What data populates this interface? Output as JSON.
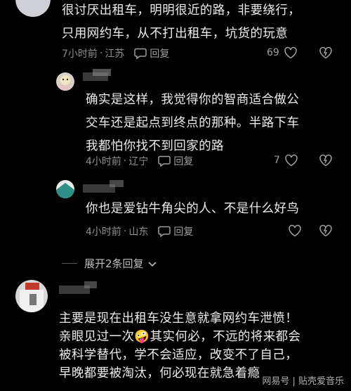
{
  "comments": [
    {
      "text_lines": [
        "很讨厌出租车，明明很近的路，非要绕行，",
        "只用网约车，从不打出租车，坑货的玩意"
      ],
      "time": "7小时前",
      "location": "江苏",
      "reply_label": "回复",
      "likes": "69"
    },
    {
      "text_lines": [
        "确实是这样，我觉得你的智商适合做公",
        "交车还是起点到终点的那种。半路下车",
        "我都怕你找不到回家的路"
      ],
      "time": "4小时前",
      "location": "辽宁",
      "reply_label": "回复",
      "likes": "7"
    },
    {
      "text_lines": [
        "你也是爱钻牛角尖的人、不是什么好鸟"
      ],
      "time": "4小时前",
      "location": "山东",
      "reply_label": "回复",
      "likes": ""
    }
  ],
  "expand_replies": "展开2条回复",
  "bottom_comment": {
    "text_lines": [
      "主要是现在出租车没生意就拿网约车泄愤！",
      "亲眼见过一次🤪其实何必，不远的将来都会",
      "被科学替代，学不会适应，改变不了自己，",
      "早晚都要被淘汰，何必现在就急着瘾"
    ]
  },
  "watermark": "网易号 | 贴壳爱音乐",
  "separator": "·",
  "icons": {
    "reply": "comment-bubble-icon",
    "like": "heart-outline-icon",
    "dislike": "broken-heart-icon",
    "chevron": "chevron-down-icon"
  }
}
